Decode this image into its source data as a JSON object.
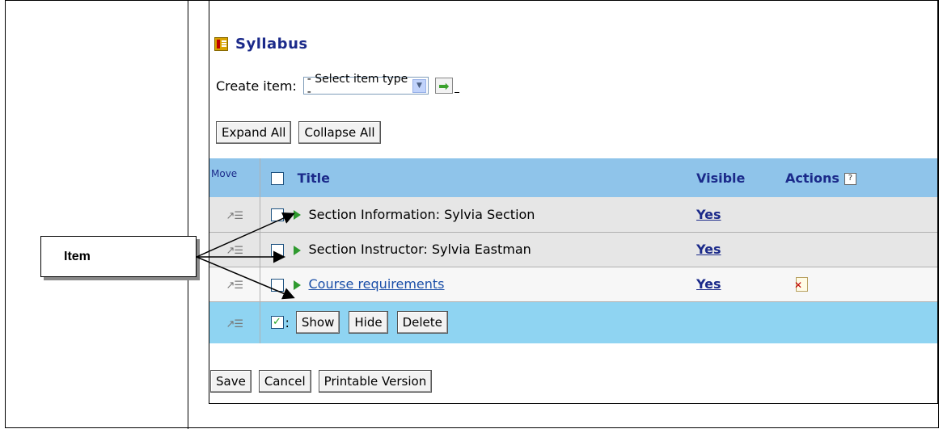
{
  "page": {
    "title": "Syllabus",
    "create_label": "Create item:",
    "select_value": "- Select item type -",
    "expand_all": "Expand All",
    "collapse_all": "Collapse All"
  },
  "table": {
    "col_move": "Move",
    "col_title": "Title",
    "col_visible": "Visible",
    "col_actions": "Actions",
    "help_glyph": "?",
    "rows": [
      {
        "title": "Section Information: Sylvia Section",
        "visible": "Yes",
        "is_link": false,
        "has_delete": false
      },
      {
        "title": "Section Instructor: Sylvia Eastman",
        "visible": "Yes",
        "is_link": false,
        "has_delete": false
      },
      {
        "title": "Course requirements",
        "visible": "Yes",
        "is_link": true,
        "has_delete": true
      }
    ],
    "bulk_show": "Show",
    "bulk_hide": "Hide",
    "bulk_delete": "Delete"
  },
  "footer": {
    "save": "Save",
    "cancel": "Cancel",
    "printable": "Printable Version"
  },
  "callout": {
    "label": "Item"
  },
  "icons": {
    "syllabus": "syllabus-icon",
    "go": "go-arrow-icon",
    "move": "move-icon",
    "expand": "expand-triangle-icon",
    "delete": "delete-document-icon",
    "help": "help-icon"
  },
  "colors": {
    "header_bg": "#8fc4ea",
    "bulk_bg": "#8fd4f2",
    "title_text": "#1b2a8a",
    "row_bg": "#e6e6e6"
  }
}
